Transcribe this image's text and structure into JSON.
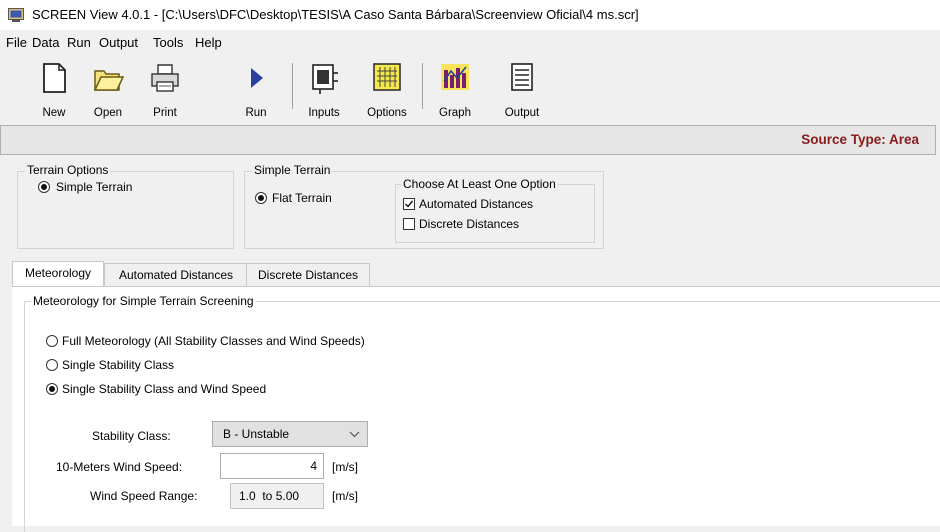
{
  "window": {
    "title": "SCREEN View 4.0.1 - [C:\\Users\\DFC\\Desktop\\TESIS\\A Caso Santa Bárbara\\Screenview Oficial\\4 ms.scr]"
  },
  "menu": [
    "File",
    "Data",
    "Run",
    "Output",
    "Tools",
    "Help"
  ],
  "toolbar": {
    "new": "New",
    "open": "Open",
    "print": "Print",
    "run": "Run",
    "inputs": "Inputs",
    "options": "Options",
    "graph": "Graph",
    "output": "Output"
  },
  "source_type": "Source Type: Area",
  "terrain_options": {
    "label": "Terrain Options",
    "radio": "Simple Terrain",
    "selected": true
  },
  "simple_terrain": {
    "label": "Simple Terrain",
    "radio": "Flat Terrain",
    "selected": true,
    "choose_label": "Choose At Least One Option",
    "automated": {
      "label": "Automated Distances",
      "checked": true
    },
    "discrete": {
      "label": "Discrete Distances",
      "checked": false
    }
  },
  "tabs": [
    "Meteorology",
    "Automated Distances",
    "Discrete Distances"
  ],
  "meteorology": {
    "group_label": "Meteorology for Simple Terrain Screening",
    "options": [
      {
        "label": "Full Meteorology (All Stability Classes and Wind Speeds)",
        "selected": false
      },
      {
        "label": "Single Stability Class",
        "selected": false
      },
      {
        "label": "Single Stability Class and Wind Speed",
        "selected": true
      }
    ],
    "stability_class_label": "Stability Class:",
    "stability_class_value": "B - Unstable",
    "wind_speed_label": "10-Meters Wind Speed:",
    "wind_speed_value": "4",
    "wind_speed_unit": "[m/s]",
    "wind_range_label": "Wind Speed Range:",
    "wind_range_value": "1.0  to 5.00",
    "wind_range_unit": "[m/s]"
  },
  "colors": {
    "source_type_text": "#8b1a1a",
    "run_arrow": "#2b3fa0"
  },
  "icons": [
    "app-icon",
    "new-icon",
    "open-icon",
    "print-icon",
    "run-icon",
    "inputs-icon",
    "options-icon",
    "graph-icon",
    "output-icon",
    "chevron-down-icon"
  ]
}
